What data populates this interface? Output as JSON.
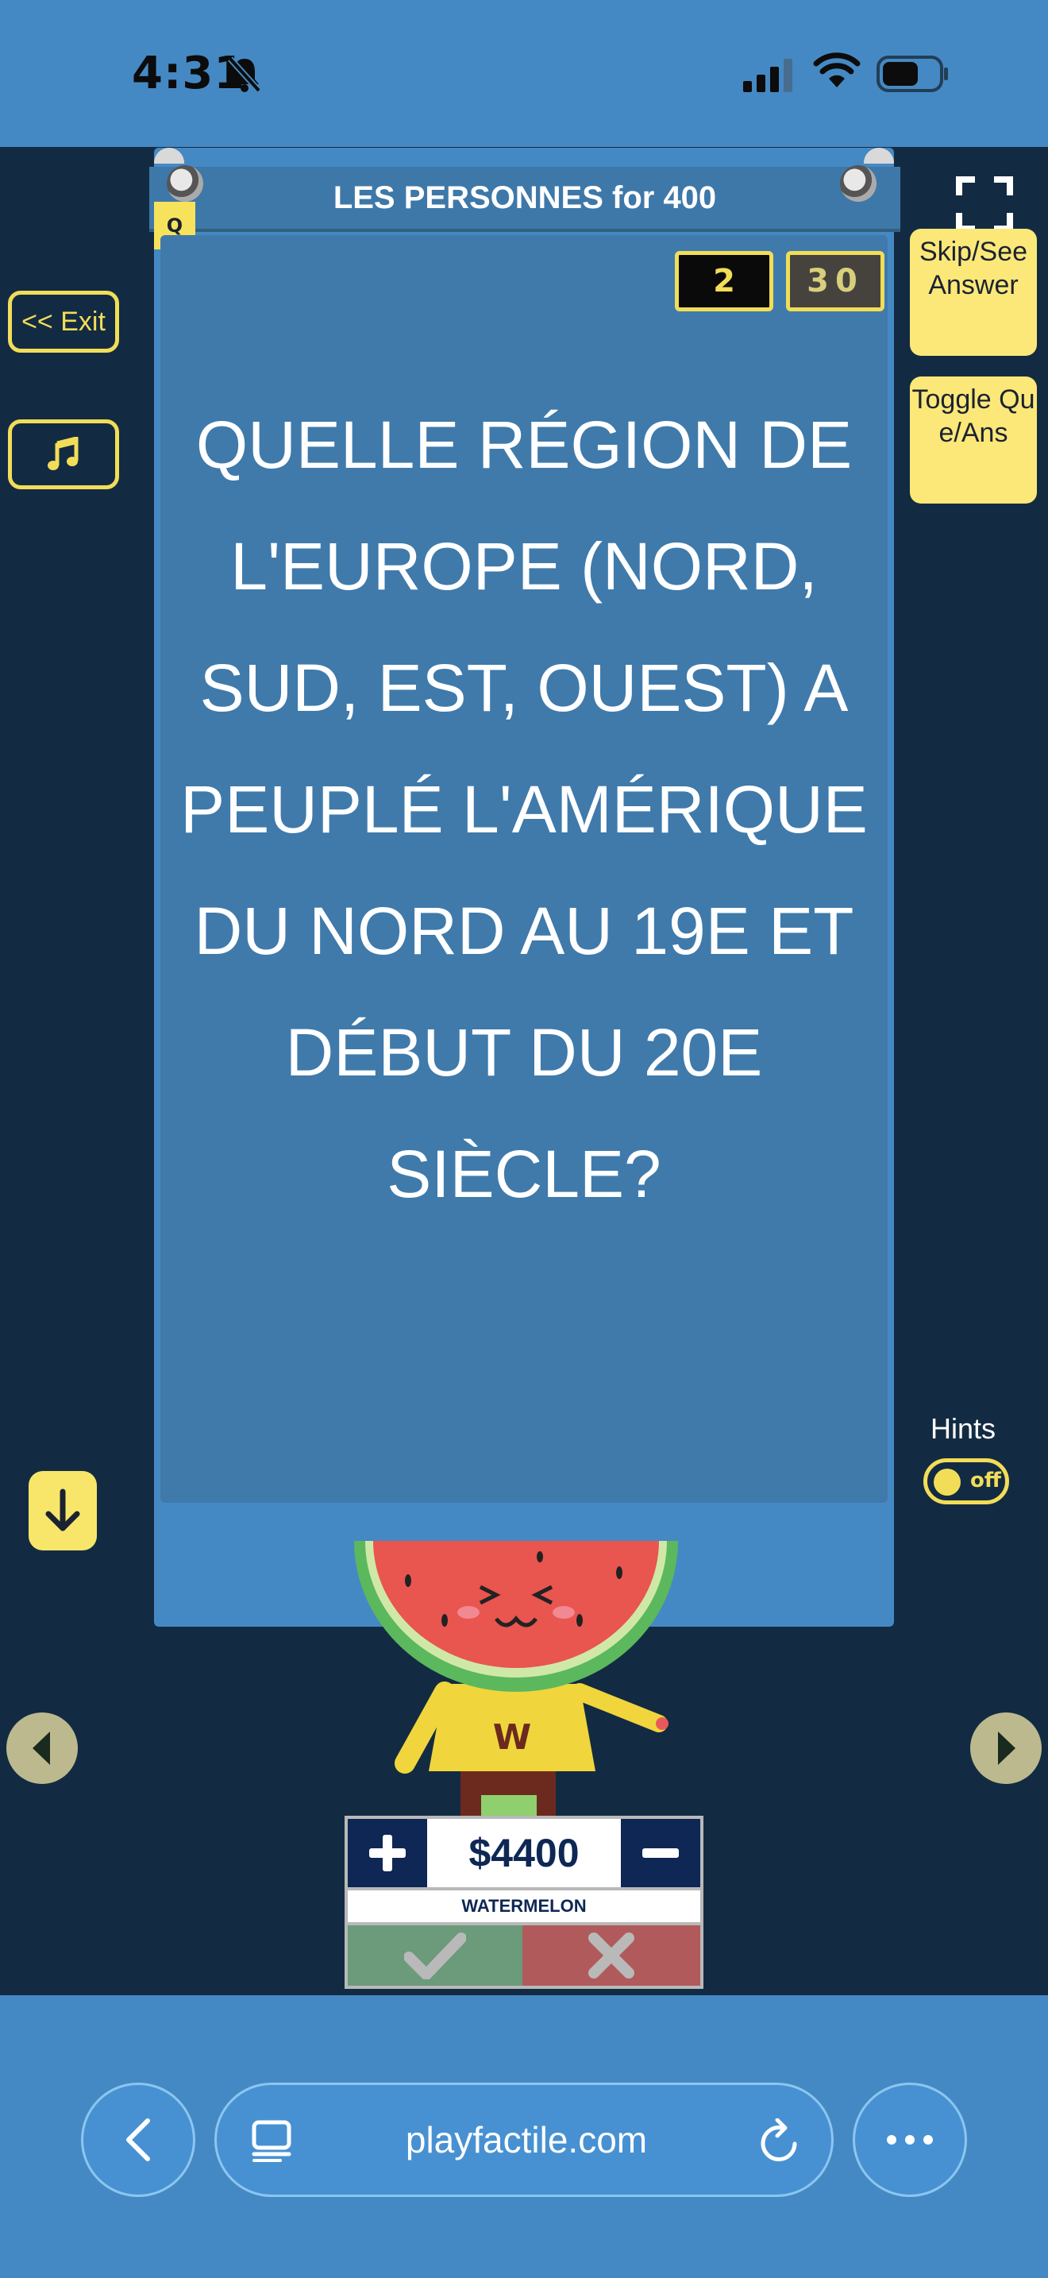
{
  "status_bar": {
    "time": "4:31"
  },
  "sidebar_left": {
    "exit_label": "<< Exit"
  },
  "sidebar_right": {
    "skip_label": "Skip/See Answer",
    "toggle_label": "Toggle Que/Ans",
    "hints_label": "Hints",
    "hints_state": "off"
  },
  "card": {
    "badge": "Q",
    "title": "LES PERSONNES for 400",
    "question_number": "2",
    "timer": "30",
    "question": "QUELLE RÉGION DE L'EUROPE (NORD, SUD, EST, OUEST) A PEUPLÉ L'AMÉRIQUE DU NORD AU 19E ET DÉBUT DU 20E SIÈCLE?"
  },
  "team": {
    "mascot_letter": "W",
    "score": "$4400",
    "name": "WATERMELON"
  },
  "browser": {
    "url": "playfactile.com"
  },
  "colors": {
    "background": "#132b42",
    "card": "#4589c4",
    "accent_yellow": "#f2dd58",
    "score_navy": "#0e2754",
    "correct_green": "#6b9b7a",
    "wrong_red": "#b15a5c"
  },
  "icons": [
    "bell-slash-icon",
    "signal-icon",
    "wifi-icon",
    "battery-icon",
    "music-note-icon",
    "arrow-down-icon",
    "fullscreen-icon",
    "chevron-left-icon",
    "chevron-right-icon",
    "plus-icon",
    "minus-icon",
    "check-icon",
    "x-icon",
    "tabs-icon",
    "reload-icon",
    "more-icon"
  ]
}
